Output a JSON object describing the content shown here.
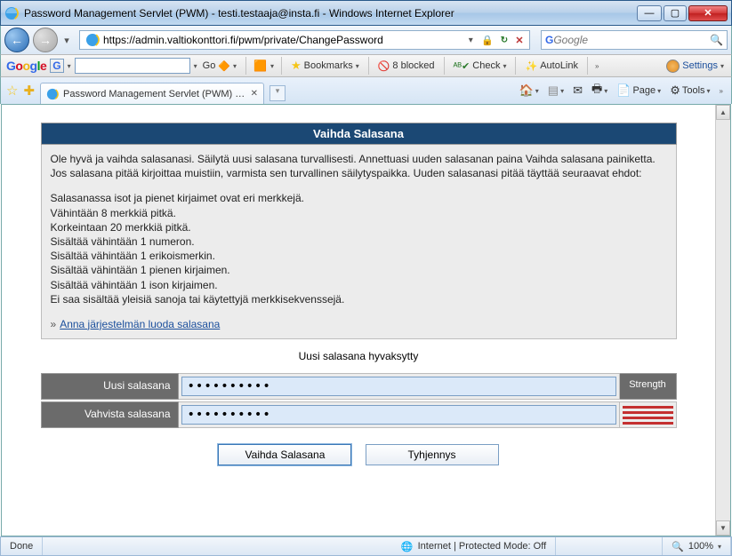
{
  "window": {
    "title": "Password Management Servlet (PWM) - testi.testaaja@insta.fi - Windows Internet Explorer"
  },
  "nav": {
    "url": "https://admin.valtiokonttori.fi/pwm/private/ChangePassword",
    "search_placeholder": "Google"
  },
  "gtoolbar": {
    "go": "Go",
    "bookmarks": "Bookmarks",
    "blocked": "8 blocked",
    "check": "Check",
    "autolink": "AutoLink",
    "settings": "Settings"
  },
  "tab": {
    "label": "Password Management Servlet (PWM) - testi.test..."
  },
  "iemenu": {
    "page": "Page",
    "tools": "Tools"
  },
  "content": {
    "heading": "Vaihda Salasana",
    "intro": "Ole hyvä ja vaihda salasanasi. Säilytä uusi salasana turvallisesti. Annettuasi uuden salasanan paina Vaihda salasana painiketta. Jos salasana pitää kirjoittaa muistiin, varmista sen turvallinen säilytyspaikka. Uuden salasanasi pitää täyttää seuraavat ehdot:",
    "rules": [
      "Salasanassa isot ja pienet kirjaimet ovat eri merkkejä.",
      "Vähintään 8 merkkiä pitkä.",
      "Korkeintaan 20 merkkiä pitkä.",
      "Sisältää vähintään 1 numeron.",
      "Sisältää vähintään 1 erikoismerkin.",
      "Sisältää vähintään 1 pienen kirjaimen.",
      "Sisältää vähintään 1 ison kirjaimen.",
      "Ei saa sisältää yleisiä sanoja tai käytettyjä merkkisekvenssejä."
    ],
    "generate_link": "Anna järjestelmän luoda salasana",
    "accepted": "Uusi salasana hyvaksytty",
    "new_label": "Uusi salasana",
    "confirm_label": "Vahvista salasana",
    "strength_label": "Strength",
    "password_value": "••••••••••",
    "submit": "Vaihda Salasana",
    "clear": "Tyhjennys"
  },
  "status": {
    "done": "Done",
    "zone": "Internet | Protected Mode: Off",
    "zoom": "100%"
  }
}
